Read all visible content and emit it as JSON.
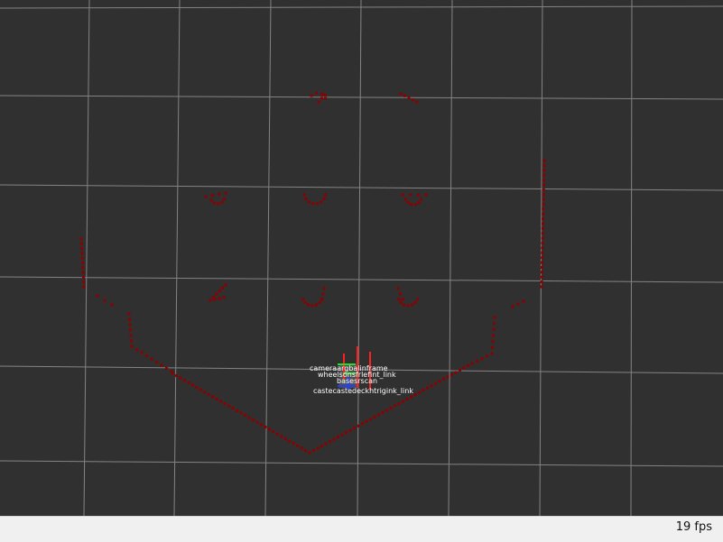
{
  "scene": {
    "background_color": "#303030",
    "grid_color": "#a0a0a0",
    "scan_color": "#8b0000",
    "frame_labels": [
      "cameraargbalinframe",
      "wheelsonsfrlefint_link",
      "basesrscan",
      "castecastedeckhtrigink_link"
    ]
  },
  "status": {
    "fps": "19 fps"
  }
}
